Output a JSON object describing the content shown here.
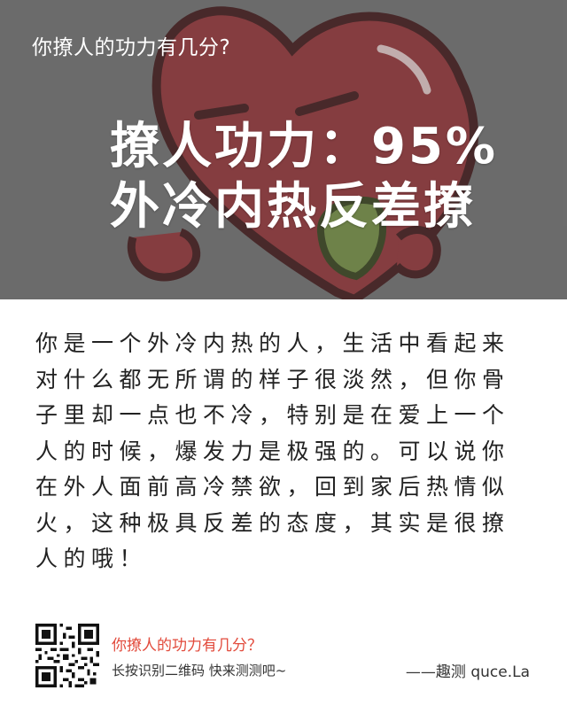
{
  "hero": {
    "title": "你撩人的功力有几分?",
    "score_line": "撩人功力：95%",
    "type_line": "外冷内热反差撩"
  },
  "result": {
    "description": "你是一个外冷内热的人，生活中看起来对什么都无所谓的样子很淡然，但你骨子里却一点也不冷，特别是在爱上一个人的时候，爆发力是极强的。可以说你在外人面前高冷禁欲，回到家后热情似火，这种极具反差的态度，其实是很撩人的哦！"
  },
  "footer": {
    "title": "你撩人的功力有几分？",
    "hint": "长按识别二维码  快来测测吧~",
    "brand": "——趣测 quce.La"
  },
  "colors": {
    "hero_bg": "#7b7b7b",
    "heart": "#9e3b3f",
    "leaf": "#7e9a4c",
    "footer_title": "#e24a3b"
  },
  "icons": {
    "hero_art": "heart-character-illustration",
    "qr": "qr-code-icon"
  }
}
